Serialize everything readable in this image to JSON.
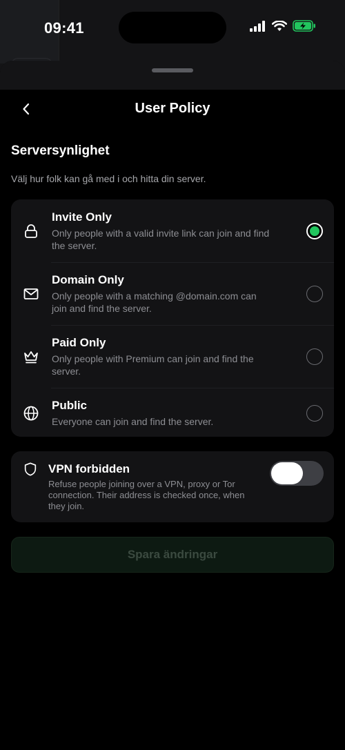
{
  "status_bar": {
    "time": "09:41"
  },
  "nav": {
    "title": "User Policy"
  },
  "section": {
    "title": "Serversynlighet",
    "description": "Välj hur folk kan gå med i och hitta din server."
  },
  "options": [
    {
      "title": "Invite Only",
      "description": "Only people with a valid invite link can join and find the server.",
      "icon": "lock-icon",
      "selected": true
    },
    {
      "title": "Domain Only",
      "description": "Only people with a matching @domain.com can join and find the server.",
      "icon": "mail-icon",
      "selected": false
    },
    {
      "title": "Paid Only",
      "description": "Only people with Premium can join and find the server.",
      "icon": "crown-icon",
      "selected": false
    },
    {
      "title": "Public",
      "description": "Everyone can join and find the server.",
      "icon": "globe-icon",
      "selected": false
    }
  ],
  "vpn": {
    "title": "VPN forbidden",
    "description": "Refuse people joining over a VPN, proxy or Tor connection. Their address is checked once, when they join.",
    "icon": "shield-icon",
    "enabled": false
  },
  "save_button": {
    "label": "Spara ändringar",
    "disabled": true
  },
  "colors": {
    "accent": "#22c55e",
    "background": "#000000",
    "card": "#131315"
  }
}
